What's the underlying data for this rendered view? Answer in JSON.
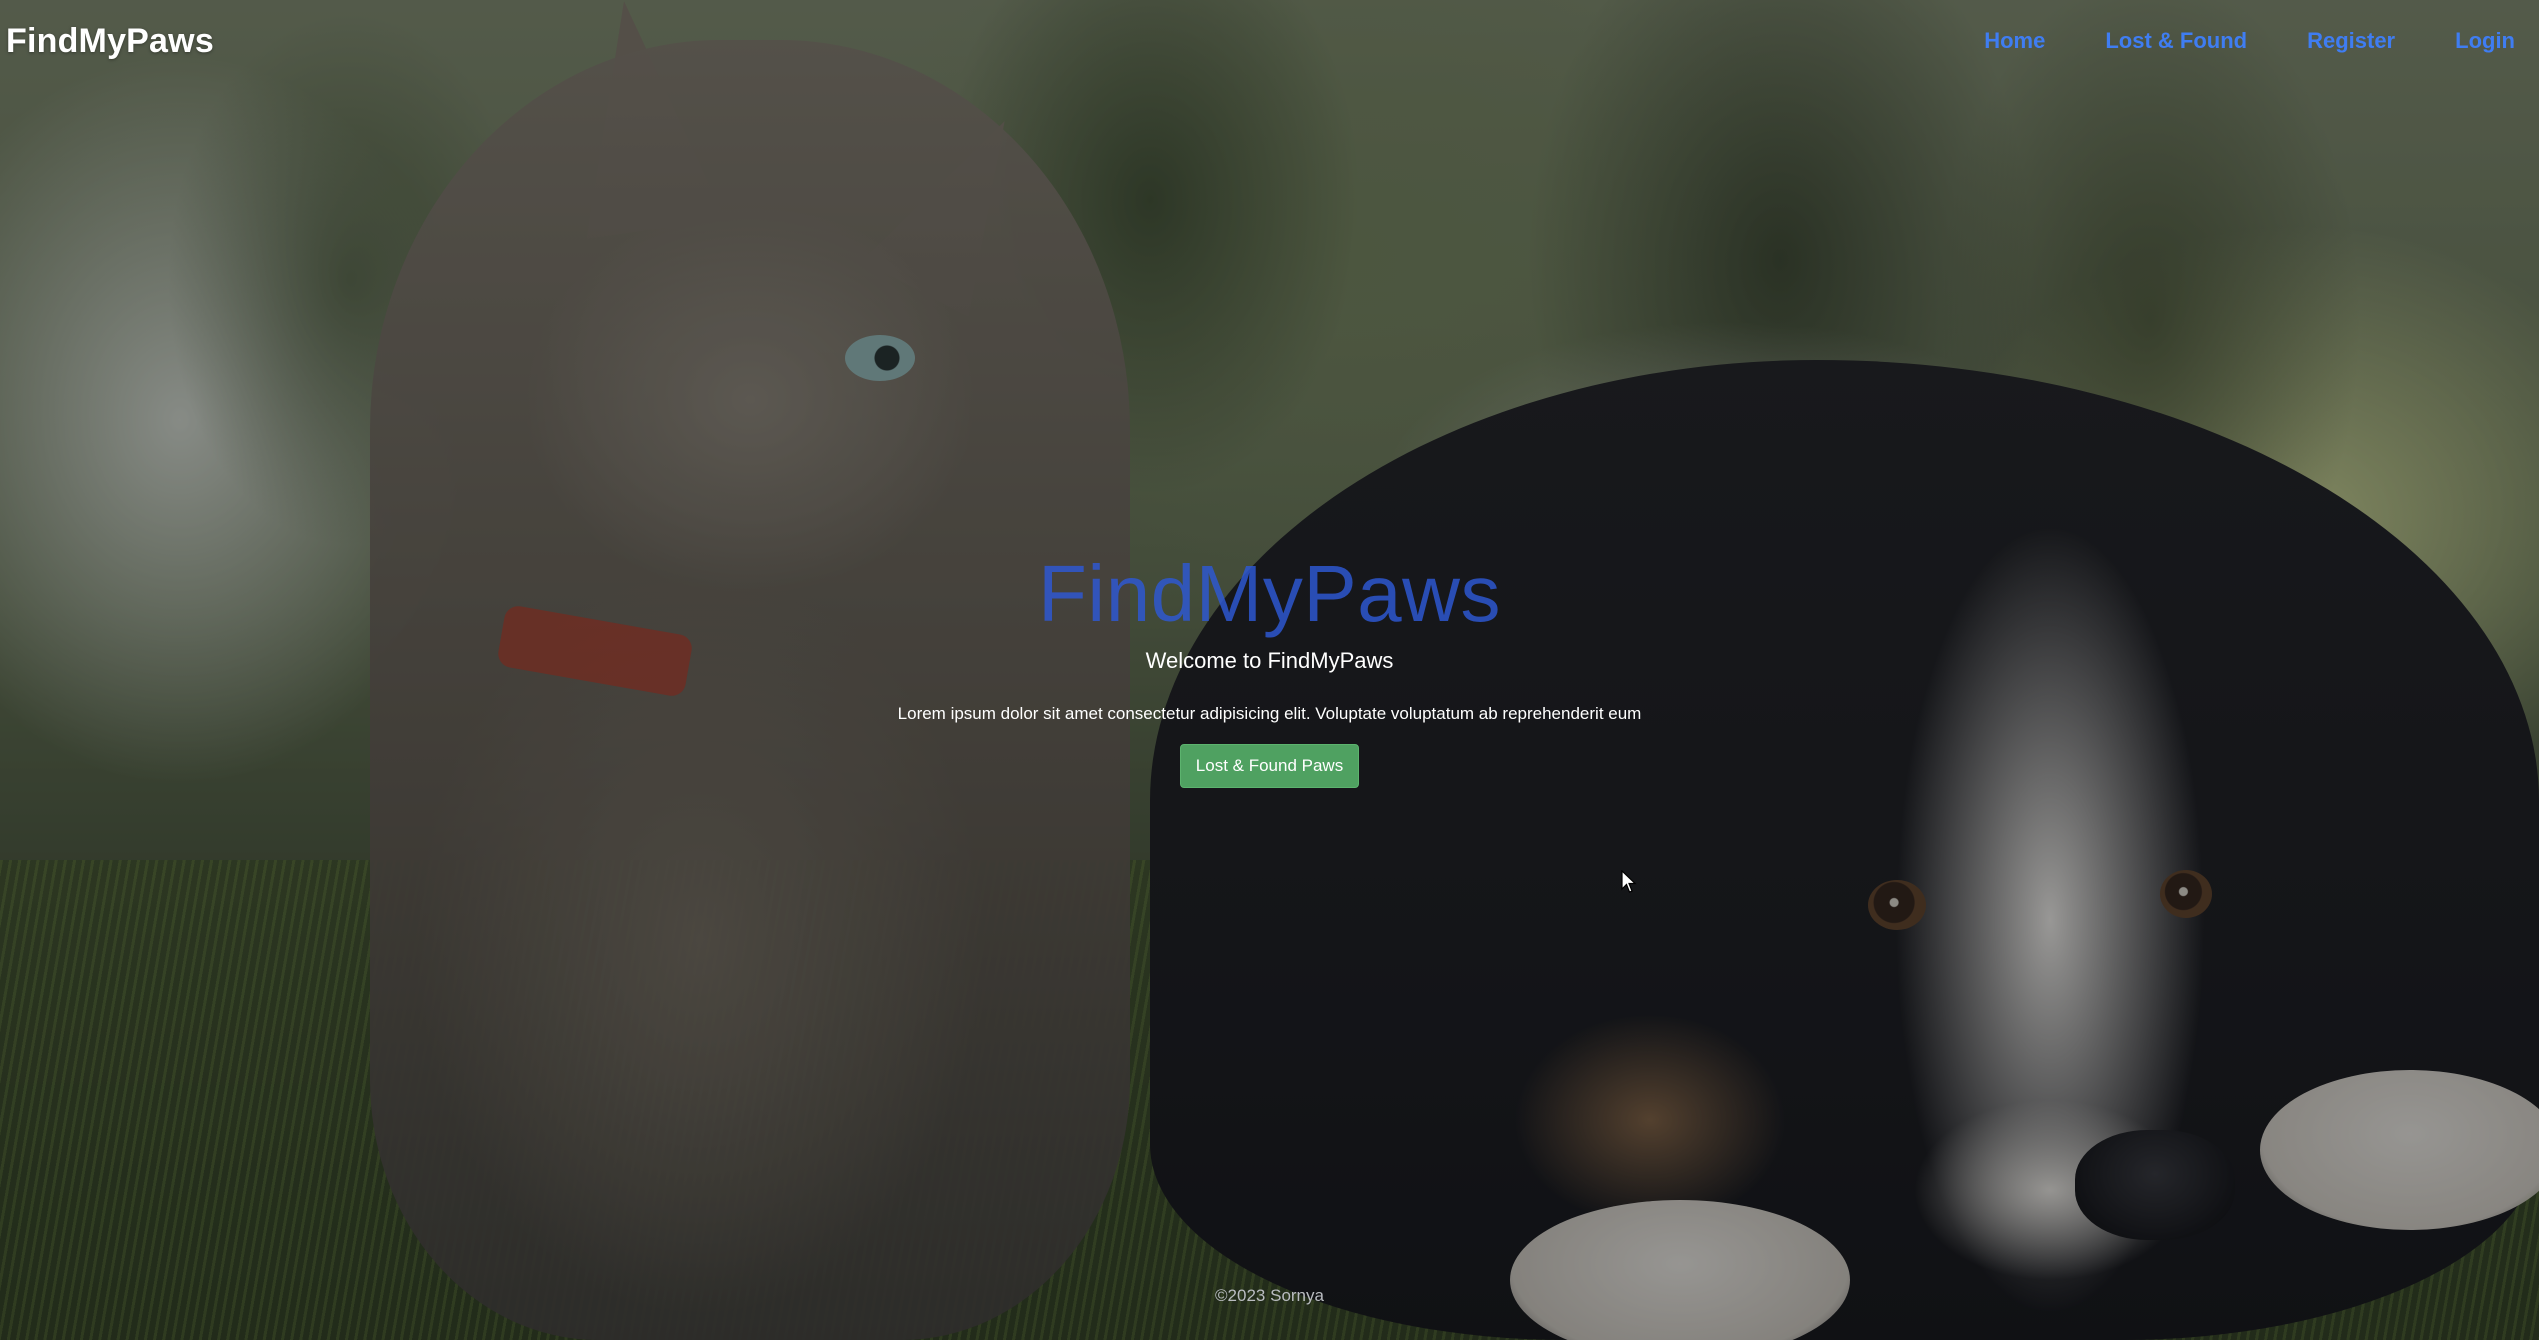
{
  "navbar": {
    "brand": "FindMyPaws",
    "links": [
      {
        "label": "Home"
      },
      {
        "label": "Lost & Found"
      },
      {
        "label": "Register"
      },
      {
        "label": "Login"
      }
    ]
  },
  "hero": {
    "title": "FindMyPaws",
    "subtitle": "Welcome to FindMyPaws",
    "text": "Lorem ipsum dolor sit amet consectetur adipisicing elit. Voluptate voluptatum ab reprehenderit eum",
    "button_label": "Lost & Found Paws"
  },
  "footer": {
    "text": "©2023 Sornya"
  },
  "colors": {
    "nav_link": "#3f7df2",
    "hero_title": "#2e59d6",
    "button": "#4fa161"
  },
  "background": {
    "image_semantic": "cat-and-puppy-in-grass-photo"
  }
}
